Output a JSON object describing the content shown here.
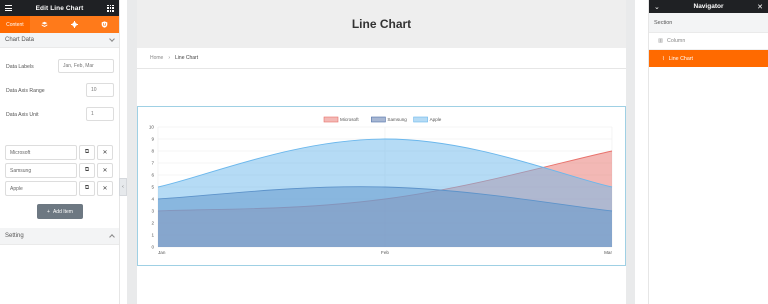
{
  "left_panel": {
    "title": "Edit Line Chart",
    "tabs": [
      "Content",
      "",
      "",
      ""
    ],
    "section_chart_data": "Chart Data",
    "fields": [
      {
        "label": "Data Labels",
        "value": "Jan, Feb, Mar"
      },
      {
        "label": "Data Axis Range",
        "value": "10"
      },
      {
        "label": "Data Axis Unit",
        "value": "1"
      }
    ],
    "items": [
      "Microsoft",
      "Samsung",
      "Apple"
    ],
    "add_item_label": "Add Item",
    "section_setting": "Setting"
  },
  "page": {
    "title": "Line Chart",
    "breadcrumb": {
      "home": "Home",
      "current": "Line Chart"
    }
  },
  "navigator": {
    "title": "Navigator",
    "section": "Section",
    "column": "Column",
    "active_item": "Line Chart"
  },
  "colors": {
    "accent": "#ff6a00",
    "dark": "#1f2124",
    "microsoft": "#e8726c",
    "samsung": "#4f6fa8",
    "apple": "#6bb7ec"
  },
  "chart_data": {
    "type": "area",
    "categories": [
      "Jan",
      "Feb",
      "Mar"
    ],
    "ylim": [
      0,
      10
    ],
    "yticks": [
      0,
      1,
      2,
      3,
      4,
      5,
      6,
      7,
      8,
      9,
      10
    ],
    "legend_position": "top",
    "series": [
      {
        "name": "Microsoft",
        "values": [
          3,
          4,
          8
        ],
        "color": "#e8726c"
      },
      {
        "name": "Samsung",
        "values": [
          4,
          5,
          3
        ],
        "color": "#4f6fa8"
      },
      {
        "name": "Apple",
        "values": [
          5,
          9,
          5
        ],
        "color": "#6bb7ec"
      }
    ]
  }
}
